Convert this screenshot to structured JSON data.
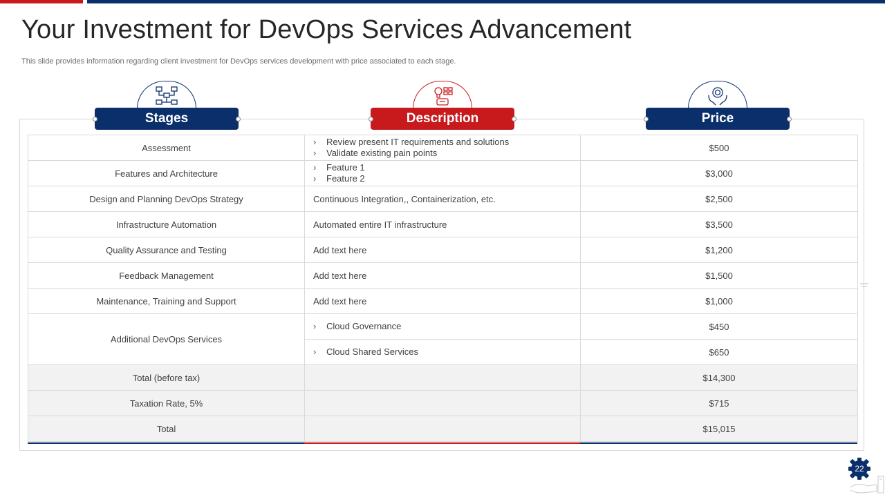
{
  "slide": {
    "title": "Your Investment for DevOps Services Advancement",
    "subtitle": "This slide provides information regarding client investment for DevOps services development with price associated to each stage.",
    "page_number": "22"
  },
  "colors": {
    "brand_red": "#c8191c",
    "brand_navy": "#0a2f6b",
    "total_row_bg": "#f2f2f2"
  },
  "headers": [
    {
      "label": "Stages",
      "icon": "network-icon"
    },
    {
      "label": "Description",
      "icon": "idea-checklist-icon"
    },
    {
      "label": "Price",
      "icon": "hand-coin-icon"
    }
  ],
  "bullet_glyph": "›",
  "rows": [
    {
      "stage": "Assessment",
      "description": [
        "Review  present  IT  requirements  and  solutions",
        "Validate  existing  pain  points"
      ],
      "price": "$500"
    },
    {
      "stage": "Features and Architecture",
      "description": [
        "Feature  1",
        "Feature  2"
      ],
      "price": "$3,000"
    },
    {
      "stage": "Design and Planning DevOps Strategy",
      "description": "Continuous  Integration,,  Containerization,  etc.",
      "price": "$2,500"
    },
    {
      "stage": "Infrastructure  Automation",
      "description": "Automated  entire  IT  infrastructure",
      "price": "$3,500"
    },
    {
      "stage": "Quality Assurance and Testing",
      "description": "Add text here",
      "price": "$1,200"
    },
    {
      "stage": "Feedback Management",
      "description": "Add text here",
      "price": "$1,500"
    },
    {
      "stage": "Maintenance,  Training  and  Support",
      "description": "Add text here",
      "price": "$1,000"
    }
  ],
  "additional": {
    "stage": "Additional DevOps Services",
    "items": [
      {
        "description": "Cloud  Governance",
        "price": "$450"
      },
      {
        "description": "Cloud  Shared  Services",
        "price": "$650"
      }
    ]
  },
  "totals": [
    {
      "label": "Total  (before  tax)",
      "value": "$14,300"
    },
    {
      "label": "Taxation Rate,  5%",
      "value": "$715"
    },
    {
      "label": "Total",
      "value": "$15,015"
    }
  ]
}
